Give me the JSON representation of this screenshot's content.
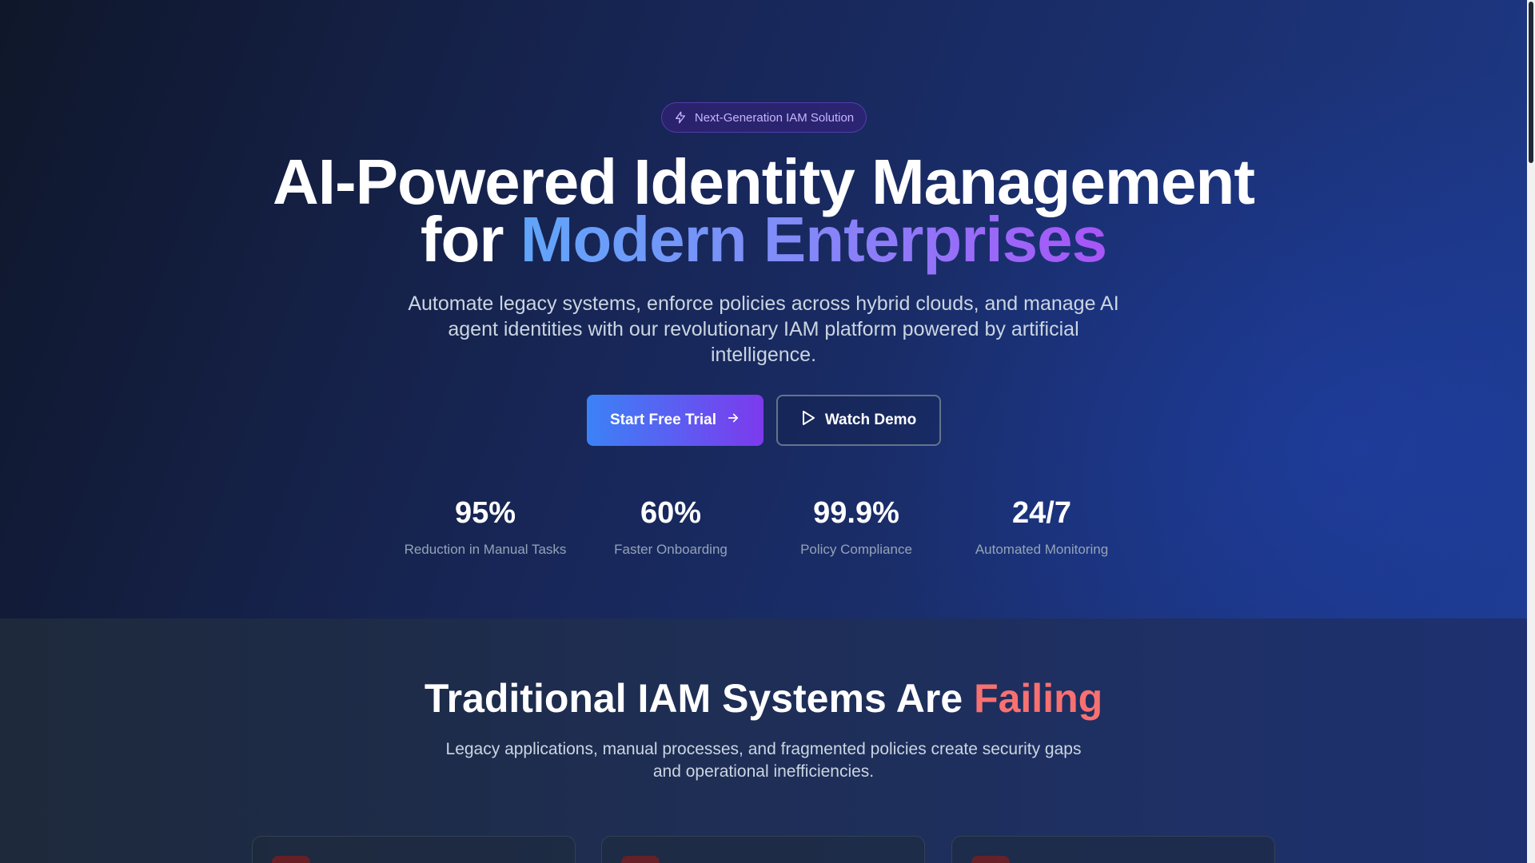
{
  "hero": {
    "badge_label": "Next-Generation IAM Solution",
    "title_line1": "AI-Powered Identity Management",
    "title_line2_prefix": "for ",
    "title_line2_highlight": "Modern Enterprises",
    "subtitle": "Automate legacy systems, enforce policies across hybrid clouds, and manage AI agent identities with our revolutionary IAM platform powered by artificial intelligence.",
    "primary_button": "Start Free Trial",
    "secondary_button": "Watch Demo",
    "stats": [
      {
        "value": "95%",
        "label": "Reduction in Manual Tasks"
      },
      {
        "value": "60%",
        "label": "Faster Onboarding"
      },
      {
        "value": "99.9%",
        "label": "Policy Compliance"
      },
      {
        "value": "24/7",
        "label": "Automated Monitoring"
      }
    ]
  },
  "problem": {
    "title_prefix": "Traditional IAM Systems Are ",
    "title_accent": "Failing",
    "subtitle": "Legacy applications, manual processes, and fragmented policies create security gaps and operational inefficiencies."
  },
  "icons": {
    "badge": "lightning-icon",
    "primary_button": "arrow-right-icon",
    "secondary_button": "play-icon"
  },
  "colors": {
    "accent_blue": "#3b82f6",
    "accent_purple": "#7c3aed",
    "danger": "#f87171",
    "badge_text": "#c4b5fd"
  }
}
